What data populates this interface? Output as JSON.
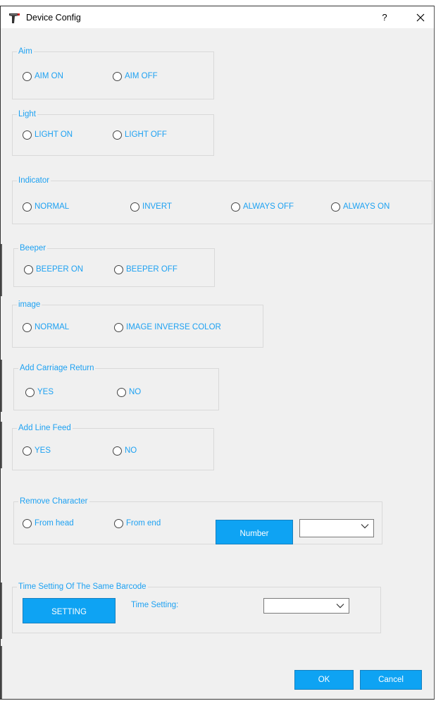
{
  "window": {
    "title": "Device Config",
    "help_label": "?"
  },
  "groups": {
    "aim": {
      "legend": "Aim",
      "options": [
        "AIM ON",
        "AIM OFF"
      ]
    },
    "light": {
      "legend": "Light",
      "options": [
        "LIGHT ON",
        "LIGHT OFF"
      ]
    },
    "indicator": {
      "legend": "Indicator",
      "options": [
        "NORMAL",
        "INVERT",
        "ALWAYS OFF",
        "ALWAYS ON"
      ]
    },
    "beeper": {
      "legend": "Beeper",
      "options": [
        "BEEPER ON",
        "BEEPER OFF"
      ]
    },
    "image": {
      "legend": "image",
      "options": [
        "NORMAL",
        "IMAGE INVERSE COLOR"
      ]
    },
    "carriage": {
      "legend": "Add Carriage Return",
      "options": [
        "YES",
        "NO"
      ]
    },
    "linefeed": {
      "legend": "Add Line Feed",
      "options": [
        "YES",
        "NO"
      ]
    },
    "remove": {
      "legend": "Remove  Character",
      "options": [
        "From head",
        "From end"
      ],
      "button_label": "Number",
      "select_value": ""
    },
    "time": {
      "legend": "Time Setting Of The Same Barcode",
      "button_label": "SETTING",
      "label": "Time Setting:",
      "select_value": ""
    }
  },
  "footer": {
    "ok_label": "OK",
    "cancel_label": "Cancel"
  },
  "colors": {
    "accent_text": "#1da1f2",
    "button_bg": "#0ea3f3"
  }
}
